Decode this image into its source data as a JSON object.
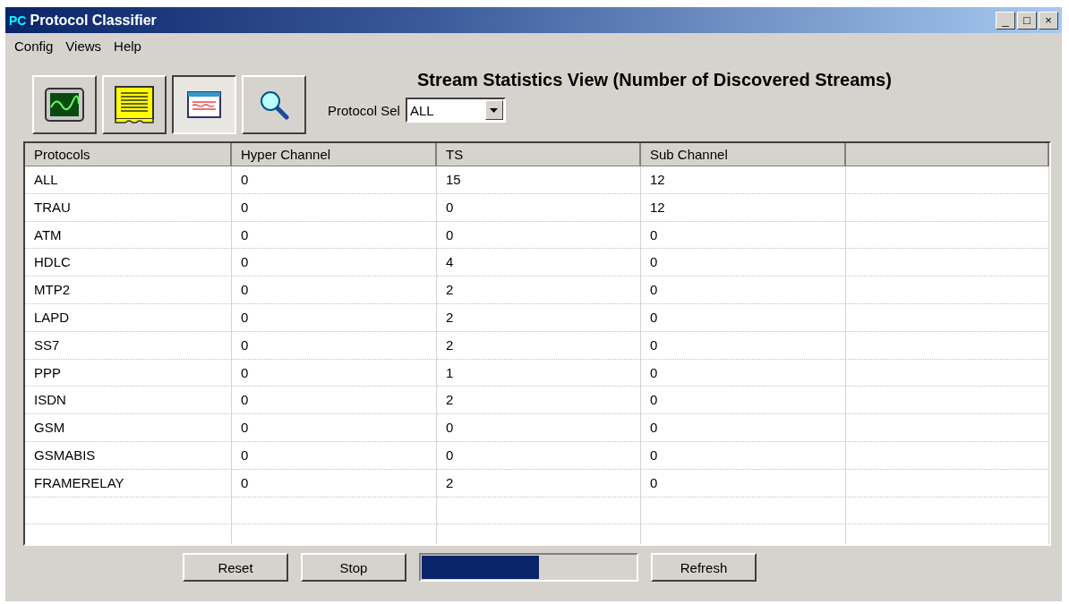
{
  "window": {
    "title_icon": "PC",
    "title": "Protocol Classifier",
    "controls": [
      "_",
      "□",
      "×"
    ]
  },
  "menu": [
    "Config",
    "Views",
    "Help"
  ],
  "toolbar": [
    {
      "kind": "monitor",
      "selected": false
    },
    {
      "kind": "tape",
      "selected": false
    },
    {
      "kind": "window",
      "selected": true
    },
    {
      "kind": "search",
      "selected": false
    }
  ],
  "view_title": "Stream Statistics View (Number of Discovered Streams)",
  "protocol_select": {
    "label": "Protocol Sel",
    "value": "ALL"
  },
  "table": {
    "columns": [
      "Protocols",
      "Hyper Channel",
      "TS",
      "Sub Channel"
    ],
    "rows": [
      [
        "ALL",
        "0",
        "15",
        "12"
      ],
      [
        "TRAU",
        "0",
        "0",
        "12"
      ],
      [
        "ATM",
        "0",
        "0",
        "0"
      ],
      [
        "HDLC",
        "0",
        "4",
        "0"
      ],
      [
        "MTP2",
        "0",
        "2",
        "0"
      ],
      [
        "LAPD",
        "0",
        "2",
        "0"
      ],
      [
        "SS7",
        "0",
        "2",
        "0"
      ],
      [
        "PPP",
        "0",
        "1",
        "0"
      ],
      [
        "ISDN",
        "0",
        "2",
        "0"
      ],
      [
        "GSM",
        "0",
        "0",
        "0"
      ],
      [
        "GSMABIS",
        "0",
        "0",
        "0"
      ],
      [
        "FRAMERELAY",
        "0",
        "2",
        "0"
      ]
    ]
  },
  "buttons": {
    "reset": "Reset",
    "stop": "Stop",
    "refresh": "Refresh"
  },
  "progress": {
    "level": 0.55
  }
}
